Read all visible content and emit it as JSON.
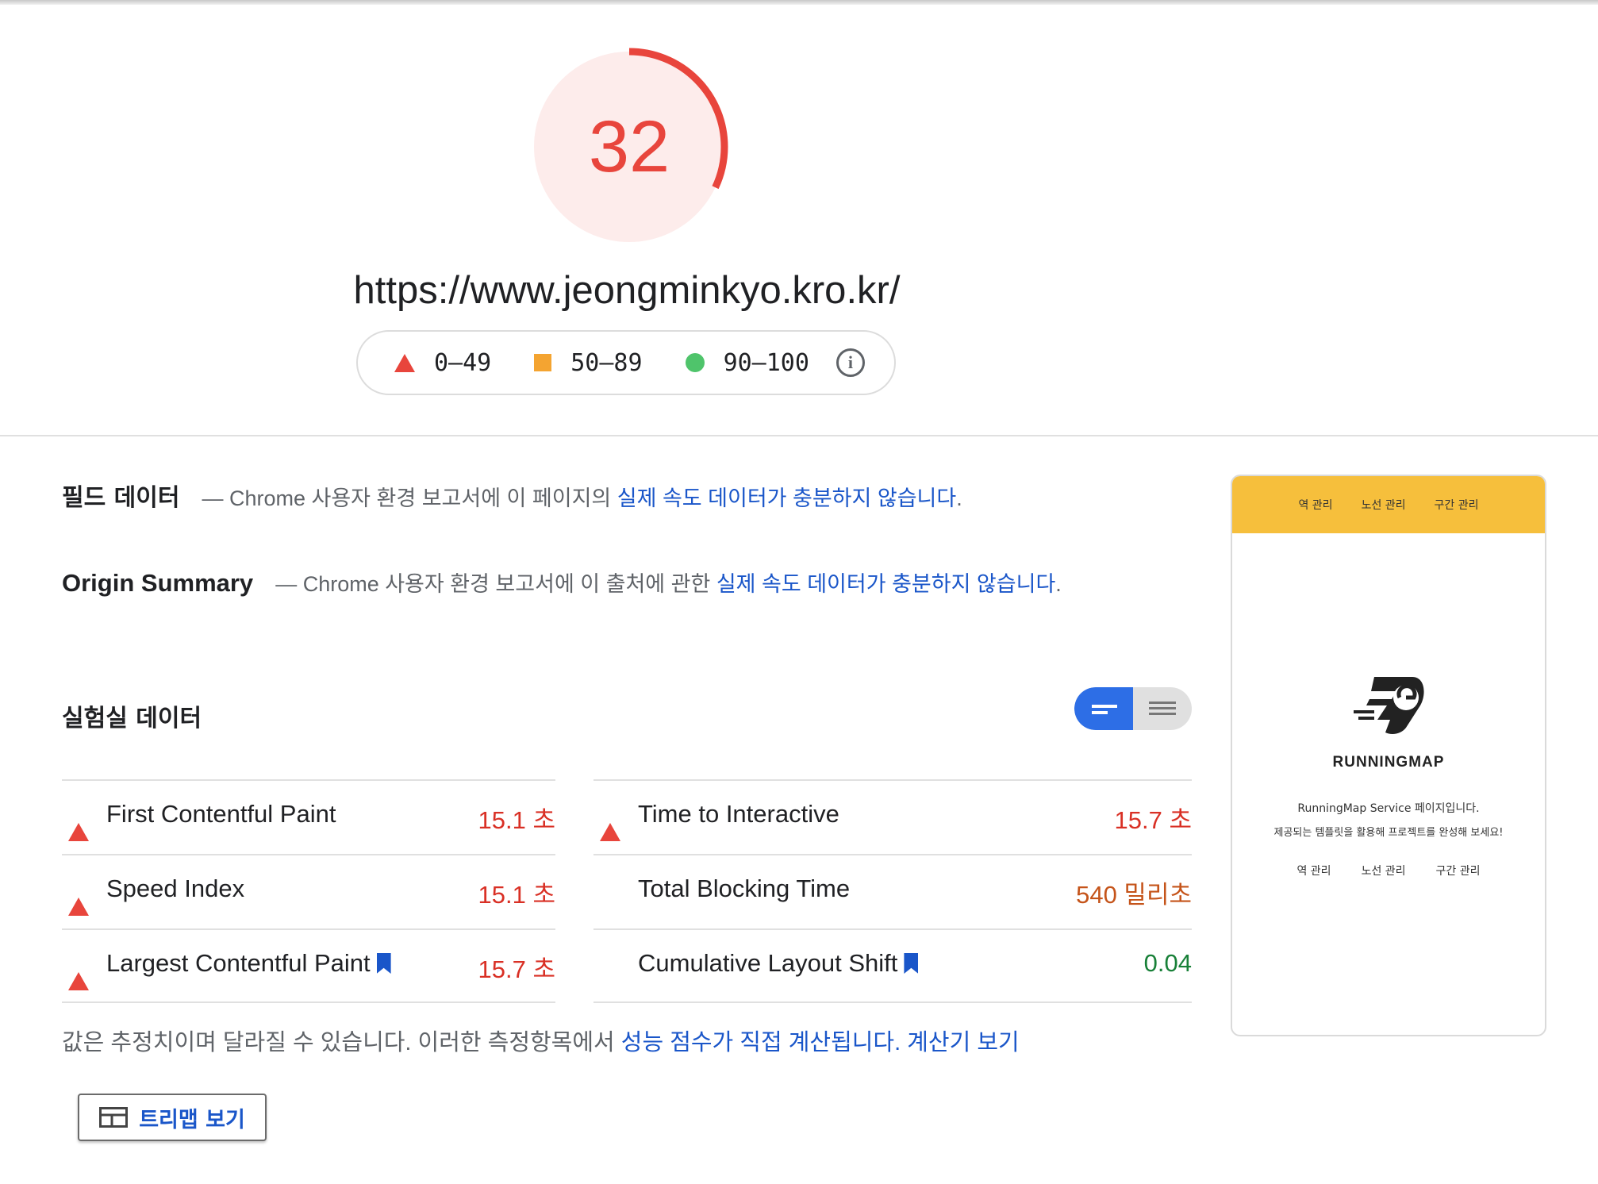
{
  "score": {
    "value": "32",
    "fraction": 0.32,
    "color": "#e8453c"
  },
  "url": "https://www.jeongminkyo.kro.kr/",
  "legend": {
    "fail": "0–49",
    "average": "50–89",
    "pass": "90–100"
  },
  "field_data": {
    "title": "필드 데이터",
    "prefix": "— Chrome 사용자 환경 보고서에 이 페이지의",
    "link": "실제 속도 데이터가 충분하지 않습니다",
    "suffix": "."
  },
  "origin_summary": {
    "title": "Origin Summary",
    "prefix": "— Chrome 사용자 환경 보고서에 이 출처에 관한",
    "link": "실제 속도 데이터가 충분하지 않습니다",
    "suffix": "."
  },
  "lab_data": {
    "title": "실험실 데이터"
  },
  "metrics_left": [
    {
      "status": "fail",
      "name": "First Contentful Paint",
      "value": "15.1 초",
      "color": "#d93025",
      "bookmark": false
    },
    {
      "status": "fail",
      "name": "Speed Index",
      "value": "15.1 초",
      "color": "#d93025",
      "bookmark": false
    },
    {
      "status": "fail",
      "name": "Largest Contentful Paint",
      "value": "15.7 초",
      "color": "#d93025",
      "bookmark": true
    }
  ],
  "metrics_right": [
    {
      "status": "fail",
      "name": "Time to Interactive",
      "value": "15.7 초",
      "color": "#d93025",
      "bookmark": false
    },
    {
      "status": "average",
      "name": "Total Blocking Time",
      "value": "540 밀리초",
      "color": "#c5541a",
      "bookmark": false
    },
    {
      "status": "pass",
      "name": "Cumulative Layout Shift",
      "value": "0.04",
      "color": "#188038",
      "bookmark": true
    }
  ],
  "note": {
    "text": "값은 추정치이며 달라질 수 있습니다. 이러한 측정항목에서 ",
    "link1": "성능 점수가 직접 계산됩니다",
    "sep": ". ",
    "link2": "계산기 보기"
  },
  "treemap_button": "트리맵 보기",
  "screenshot": {
    "nav": [
      "역 관리",
      "노선 관리",
      "구간 관리"
    ],
    "brand": "RUNNINGMAP",
    "line1": "RunningMap Service 페이지입니다.",
    "line2": "제공되는 템플릿을 활용해 프로젝트를 완성해 보세요!",
    "links": [
      "역 관리",
      "노선 관리",
      "구간 관리"
    ]
  }
}
